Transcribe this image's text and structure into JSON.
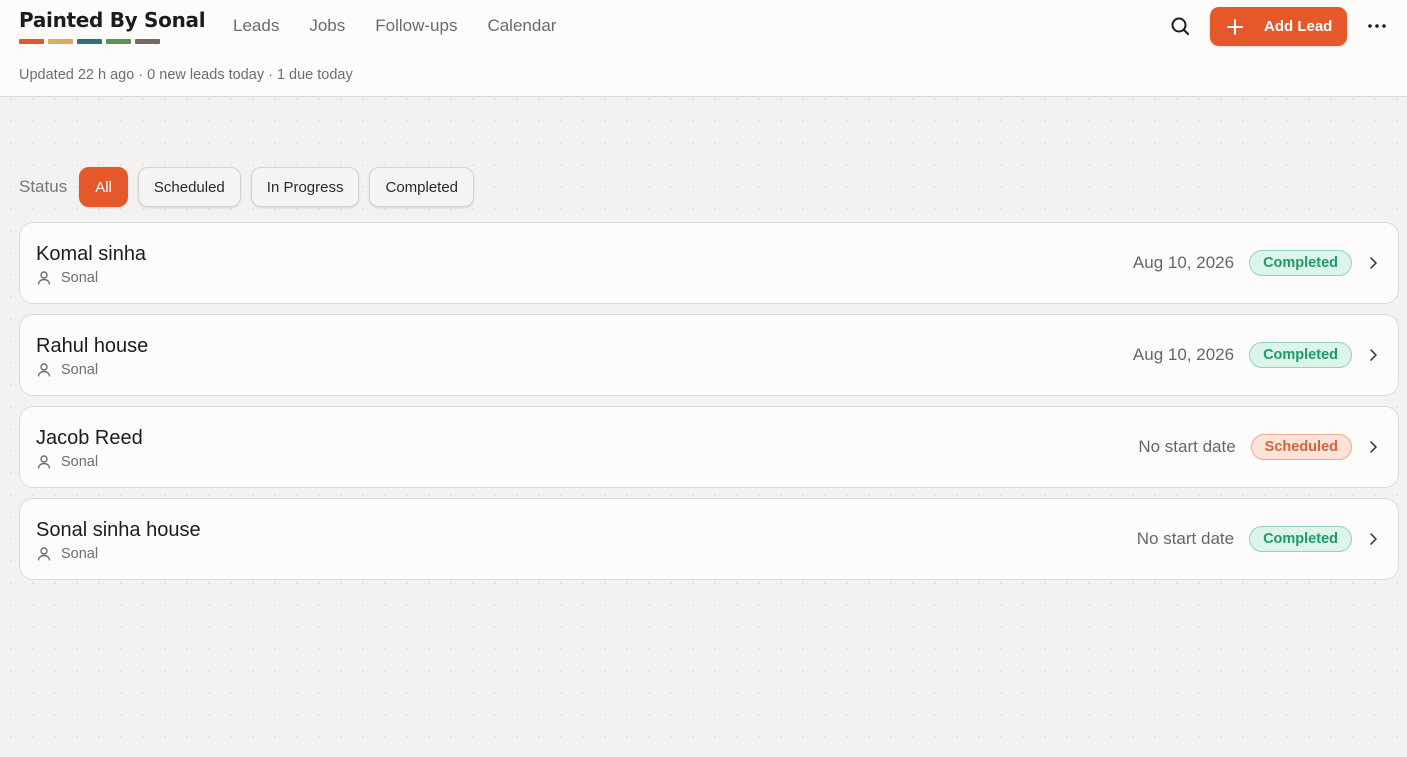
{
  "brand": {
    "title": "Painted By Sonal",
    "swatches": [
      "#e0592a",
      "#d4b056",
      "#2e7275",
      "#5a9258",
      "#736a65"
    ]
  },
  "nav": {
    "tabs": [
      {
        "label": "Leads",
        "active": false
      },
      {
        "label": "Jobs",
        "active": true
      },
      {
        "label": "Follow-ups",
        "active": false
      },
      {
        "label": "Calendar",
        "active": false
      }
    ]
  },
  "header": {
    "subtitle": "Updated 22 h ago · 0 new leads today · 1 due today",
    "add_button_label": "Add Lead",
    "icons": {
      "search": "search-icon",
      "add": "plus-icon",
      "more": "more-horizontal-icon"
    }
  },
  "filters": {
    "label": "Status",
    "options": [
      {
        "label": "All",
        "active": true
      },
      {
        "label": "Scheduled",
        "active": false
      },
      {
        "label": "In Progress",
        "active": false
      },
      {
        "label": "Completed",
        "active": false
      }
    ]
  },
  "jobs": [
    {
      "name": "Komal sinha",
      "owner": "Sonal",
      "date": "Aug 10, 2026",
      "status": "Completed",
      "status_kind": "completed"
    },
    {
      "name": "Rahul house",
      "owner": "Sonal",
      "date": "Aug 10, 2026",
      "status": "Completed",
      "status_kind": "completed"
    },
    {
      "name": "Jacob Reed",
      "owner": "Sonal",
      "date": "No start date",
      "status": "Scheduled",
      "status_kind": "scheduled"
    },
    {
      "name": "Sonal sinha house",
      "owner": "Sonal",
      "date": "No start date",
      "status": "Completed",
      "status_kind": "completed"
    }
  ],
  "colors": {
    "accent": "#e4582a",
    "completed_text": "#1f9a6a",
    "scheduled_text": "#d4643c",
    "background": "#f3f2f0"
  }
}
